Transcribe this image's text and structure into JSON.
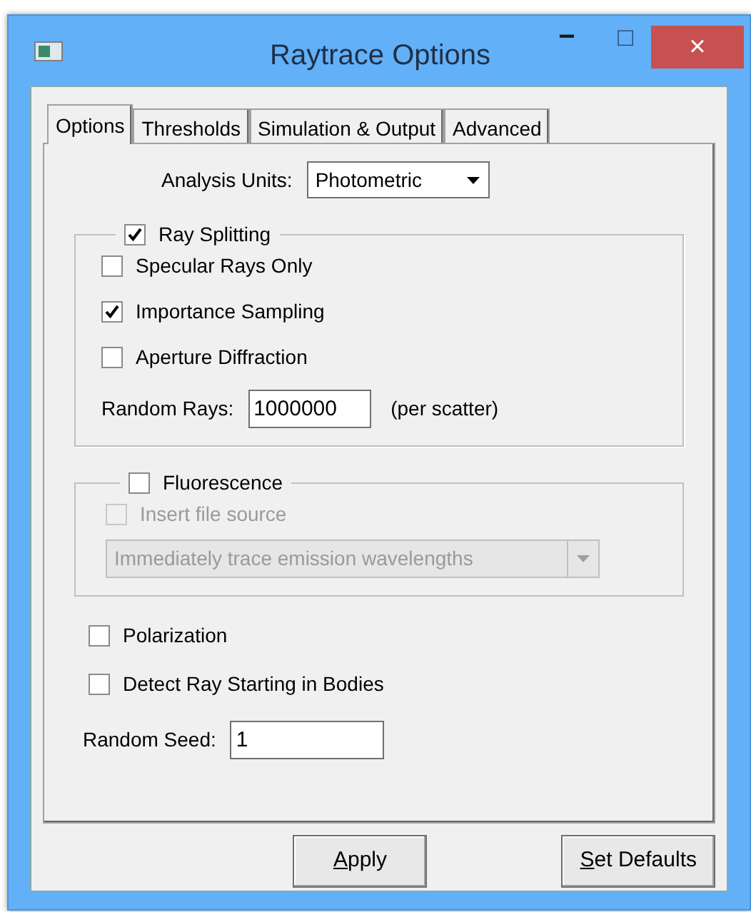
{
  "window": {
    "title": "Raytrace Options",
    "controls": [
      "−",
      "□",
      "×"
    ]
  },
  "tabs": [
    {
      "label": "Options",
      "selected": true
    },
    {
      "label": "Thresholds",
      "selected": false
    },
    {
      "label": "Simulation & Output",
      "selected": false
    },
    {
      "label": "Advanced",
      "selected": false
    }
  ],
  "analysis_units": {
    "label": "Analysis Units:",
    "value": "Photometric"
  },
  "ray_splitting": {
    "label": "Ray Splitting",
    "checked": true,
    "options": [
      {
        "label": "Specular Rays Only",
        "checked": false
      },
      {
        "label": "Importance Sampling",
        "checked": true
      },
      {
        "label": "Aperture Diffraction",
        "checked": false
      }
    ],
    "random_rays": {
      "label": "Random Rays:",
      "value": "1000000",
      "suffix": "(per scatter)"
    }
  },
  "fluorescence": {
    "label": "Fluorescence",
    "checked": false,
    "insert_file_source": {
      "label": "Insert file source",
      "checked": false,
      "disabled": true
    },
    "trace_mode": {
      "value": "Immediately trace emission wavelengths",
      "disabled": true
    }
  },
  "options": [
    {
      "label": "Polarization",
      "checked": false
    },
    {
      "label": "Detect Ray Starting in Bodies",
      "checked": false
    }
  ],
  "random_seed": {
    "label": "Random Seed:",
    "value": "1"
  },
  "buttons": [
    {
      "label_parts": [
        {
          "text": "A",
          "underlined": true
        },
        {
          "text": "pply",
          "underlined": false
        }
      ]
    },
    {
      "label_parts": [
        {
          "text": "S",
          "underlined": true
        },
        {
          "text": "et Defaults",
          "underlined": false
        }
      ]
    }
  ]
}
